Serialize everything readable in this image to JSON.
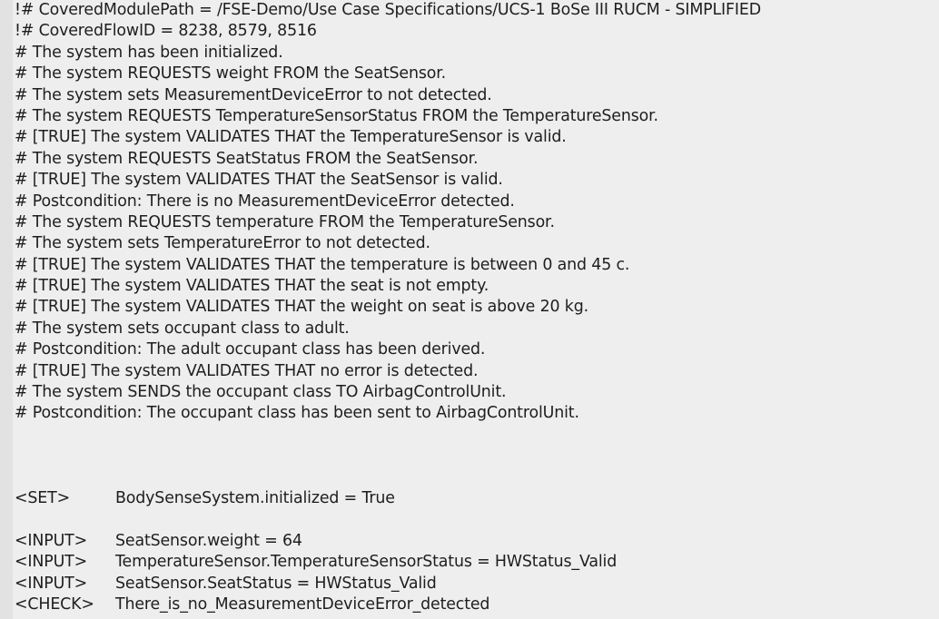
{
  "header_lines": [
    "!# CoveredModulePath = /FSE-Demo/Use Case Specifications/UCS-1 BoSe III RUCM - SIMPLIFIED",
    "!# CoveredFlowID = 8238, 8579, 8516"
  ],
  "comment_lines": [
    "# The system has been initialized.",
    "# The system REQUESTS weight FROM the SeatSensor.",
    "# The system sets MeasurementDeviceError to not detected.",
    "# The system REQUESTS TemperatureSensorStatus FROM the TemperatureSensor.",
    "# [TRUE] The system VALIDATES THAT the TemperatureSensor is valid.",
    "# The system REQUESTS SeatStatus FROM the SeatSensor.",
    "# [TRUE] The system VALIDATES THAT the SeatSensor is valid.",
    "# Postcondition: There is no MeasurementDeviceError detected.",
    "# The system REQUESTS temperature FROM the TemperatureSensor.",
    "# The system sets TemperatureError to not detected.",
    "# [TRUE] The system VALIDATES THAT the temperature is between 0 and 45 c.",
    "# [TRUE] The system VALIDATES THAT the seat is not empty.",
    "# [TRUE] The system VALIDATES THAT the weight on seat is above 20 kg.",
    "# The system sets occupant class to adult.",
    "# Postcondition: The adult occupant class has been derived.",
    "# [TRUE] The system VALIDATES THAT no error is detected.",
    "# The system SENDS the occupant class TO AirbagControlUnit.",
    "# Postcondition: The occupant class has been sent to AirbagControlUnit."
  ],
  "set_line": {
    "tag": "<SET>",
    "value": "BodySenseSystem.initialized = True"
  },
  "step_lines": [
    {
      "tag": "<INPUT>",
      "value": "SeatSensor.weight = 64"
    },
    {
      "tag": "<INPUT>",
      "value": "TemperatureSensor.TemperatureSensorStatus = HWStatus_Valid"
    },
    {
      "tag": "<INPUT>",
      "value": "SeatSensor.SeatStatus = HWStatus_Valid"
    },
    {
      "tag": "<CHECK>",
      "value": "There_is_no_MeasurementDeviceError_detected"
    }
  ]
}
